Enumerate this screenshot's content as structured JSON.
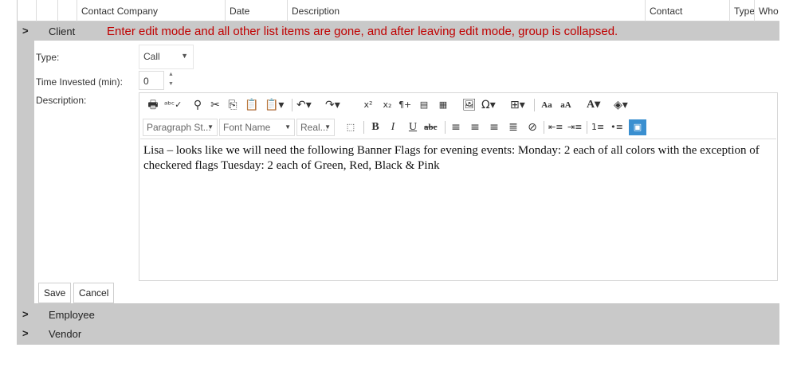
{
  "header": {
    "columns": [
      "Contact Company",
      "Date",
      "Description",
      "Contact",
      "Type",
      "Who"
    ]
  },
  "groups": {
    "client": {
      "label": "Client",
      "note": "Enter edit mode and all other list items are gone, and after leaving edit mode, group is collapsed."
    },
    "employee": {
      "label": "Employee"
    },
    "vendor": {
      "label": "Vendor"
    }
  },
  "form": {
    "type_label": "Type:",
    "type_value": "Call",
    "time_label": "Time Invested (min):",
    "time_value": "0",
    "description_label": "Description:",
    "editor": {
      "paragraph_style": "Paragraph St...",
      "font_name": "Font Name",
      "font_size": "Real...",
      "content": "Lisa – looks like we will need the following Banner Flags for evening events: Monday: 2 each of all colors with the exception of checkered flags Tuesday: 2 each of Green, Red, Black & Pink"
    },
    "save_label": "Save",
    "cancel_label": "Cancel"
  }
}
